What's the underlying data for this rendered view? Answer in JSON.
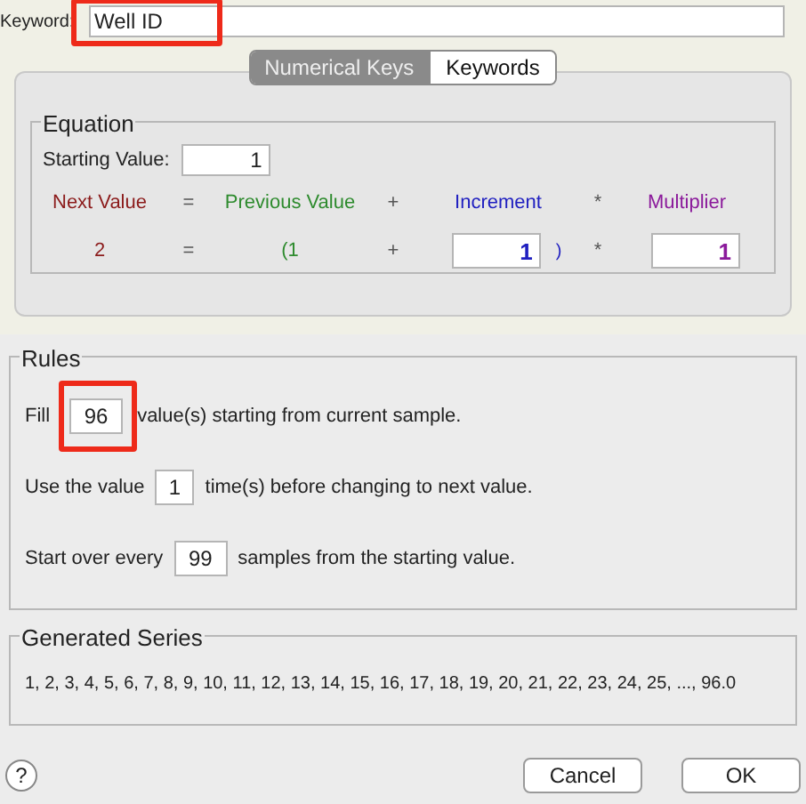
{
  "keyword": {
    "label": "Keyword:",
    "value": "Well ID",
    "highlighted": true
  },
  "tabs": [
    {
      "label": "Numerical Keys",
      "selected": true
    },
    {
      "label": "Keywords",
      "selected": false
    }
  ],
  "equation": {
    "title": "Equation",
    "starting_label": "Starting Value:",
    "starting_value": "1",
    "terms": [
      {
        "kind": "text",
        "header": "Next Value",
        "value": "2",
        "color": "#8b1a1a"
      },
      {
        "kind": "operator",
        "header": "=",
        "value": "="
      },
      {
        "kind": "text",
        "header": "Previous Value",
        "value": "(1",
        "color": "#2e8b2e"
      },
      {
        "kind": "operator",
        "header": "+",
        "value": "+"
      },
      {
        "kind": "field",
        "header": "Increment",
        "value": "1",
        "suffix": ")",
        "color": "#2020c0"
      },
      {
        "kind": "operator",
        "header": "*",
        "value": "*"
      },
      {
        "kind": "field",
        "header": "Multiplier",
        "value": "1",
        "color": "#8b1a9b"
      }
    ]
  },
  "rules": {
    "title": "Rules",
    "lines": [
      {
        "before": "Fill",
        "value": "96",
        "after": "value(s) starting from current sample.",
        "highlighted": true
      },
      {
        "before": "Use the value",
        "value": "1",
        "after": "time(s) before changing to next value.",
        "highlighted": false
      },
      {
        "before": "Start over every",
        "value": "99",
        "after": "samples from the starting value.",
        "highlighted": false
      }
    ]
  },
  "series": {
    "title": "Generated Series",
    "text": "1, 2, 3, 4, 5, 6, 7, 8, 9, 10, 11, 12, 13, 14, 15, 16, 17, 18, 19, 20, 21, 22, 23, 24, 25, ..., 96.0"
  },
  "help": "?",
  "buttons": [
    "Cancel",
    "OK"
  ]
}
